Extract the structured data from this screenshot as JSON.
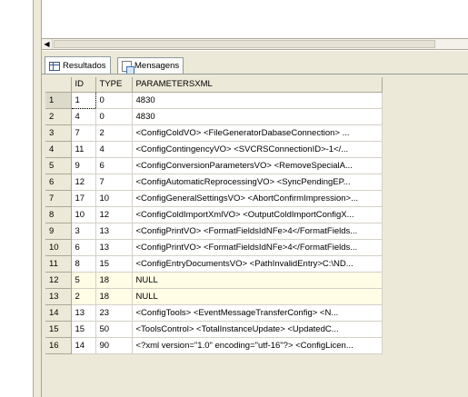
{
  "tabs": [
    {
      "label": "Resultados",
      "icon": "grid-icon"
    },
    {
      "label": "Mensagens",
      "icon": "messages-icon"
    }
  ],
  "columns": [
    "ID",
    "TYPE",
    "PARAMETERSXML"
  ],
  "rows": [
    {
      "n": "1",
      "id": "1",
      "type": "0",
      "xml": "4830"
    },
    {
      "n": "2",
      "id": "4",
      "type": "0",
      "xml": "4830"
    },
    {
      "n": "3",
      "id": "7",
      "type": "2",
      "xml": "<ConfigColdVO>   <FileGeneratorDabaseConnection>   ..."
    },
    {
      "n": "4",
      "id": "11",
      "type": "4",
      "xml": "<ConfigContingencyVO>   <SVCRSConnectionID>-1</..."
    },
    {
      "n": "5",
      "id": "9",
      "type": "6",
      "xml": "<ConfigConversionParametersVO>   <RemoveSpecialA..."
    },
    {
      "n": "6",
      "id": "12",
      "type": "7",
      "xml": "<ConfigAutomaticReprocessingVO>   <SyncPendingEP..."
    },
    {
      "n": "7",
      "id": "17",
      "type": "10",
      "xml": "<ConfigGeneralSettingsVO>   <AbortConfirmImpression>..."
    },
    {
      "n": "8",
      "id": "10",
      "type": "12",
      "xml": "<ConfigColdImportXmlVO>   <OutputColdImportConfigX..."
    },
    {
      "n": "9",
      "id": "3",
      "type": "13",
      "xml": "<ConfigPrintVO>   <FormatFieldsIdNFe>4</FormatFields..."
    },
    {
      "n": "10",
      "id": "6",
      "type": "13",
      "xml": "<ConfigPrintVO>   <FormatFieldsIdNFe>4</FormatFields..."
    },
    {
      "n": "11",
      "id": "8",
      "type": "15",
      "xml": "<ConfigEntryDocumentsVO>   <PathInvalidEntry>C:\\ND..."
    },
    {
      "n": "12",
      "id": "5",
      "type": "18",
      "xml": "NULL"
    },
    {
      "n": "13",
      "id": "2",
      "type": "18",
      "xml": "NULL"
    },
    {
      "n": "14",
      "id": "13",
      "type": "23",
      "xml": "<ConfigTools>   <EventMessageTransferConfig>   <N..."
    },
    {
      "n": "15",
      "id": "15",
      "type": "50",
      "xml": "<ToolsControl>   <TotalInstanceUpdate>   <UpdatedC..."
    },
    {
      "n": "16",
      "id": "14",
      "type": "90",
      "xml": "<?xml version=\"1.0\" encoding=\"utf-16\"?>  <ConfigLicen..."
    }
  ]
}
